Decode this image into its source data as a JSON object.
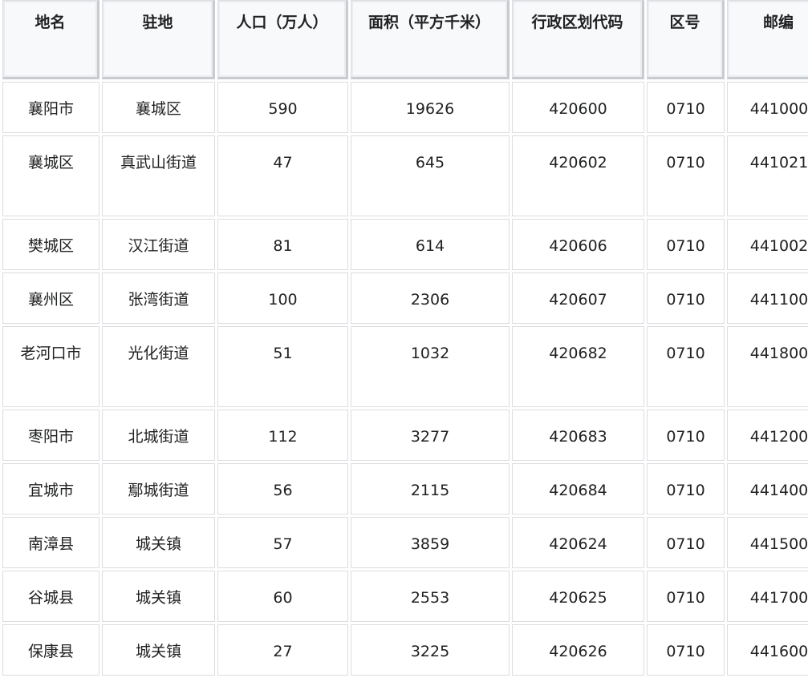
{
  "table": {
    "headers": [
      "地名",
      "驻地",
      "人口（万人）",
      "面积（平方千米）",
      "行政区划代码",
      "区号",
      "邮编"
    ],
    "rows": [
      [
        "襄阳市",
        "襄城区",
        "590",
        "19626",
        "420600",
        "0710",
        "441000"
      ],
      [
        "襄城区",
        "真武山街道",
        "47",
        "645",
        "420602",
        "0710",
        "441021"
      ],
      [
        "樊城区",
        "汉江街道",
        "81",
        "614",
        "420606",
        "0710",
        "441002"
      ],
      [
        "襄州区",
        "张湾街道",
        "100",
        "2306",
        "420607",
        "0710",
        "441100"
      ],
      [
        "老河口市",
        "光化街道",
        "51",
        "1032",
        "420682",
        "0710",
        "441800"
      ],
      [
        "枣阳市",
        "北城街道",
        "112",
        "3277",
        "420683",
        "0710",
        "441200"
      ],
      [
        "宜城市",
        "鄢城街道",
        "56",
        "2115",
        "420684",
        "0710",
        "441400"
      ],
      [
        "南漳县",
        "城关镇",
        "57",
        "3859",
        "420624",
        "0710",
        "441500"
      ],
      [
        "谷城县",
        "城关镇",
        "60",
        "2553",
        "420625",
        "0710",
        "441700"
      ],
      [
        "保康县",
        "城关镇",
        "27",
        "3225",
        "420626",
        "0710",
        "441600"
      ]
    ]
  }
}
